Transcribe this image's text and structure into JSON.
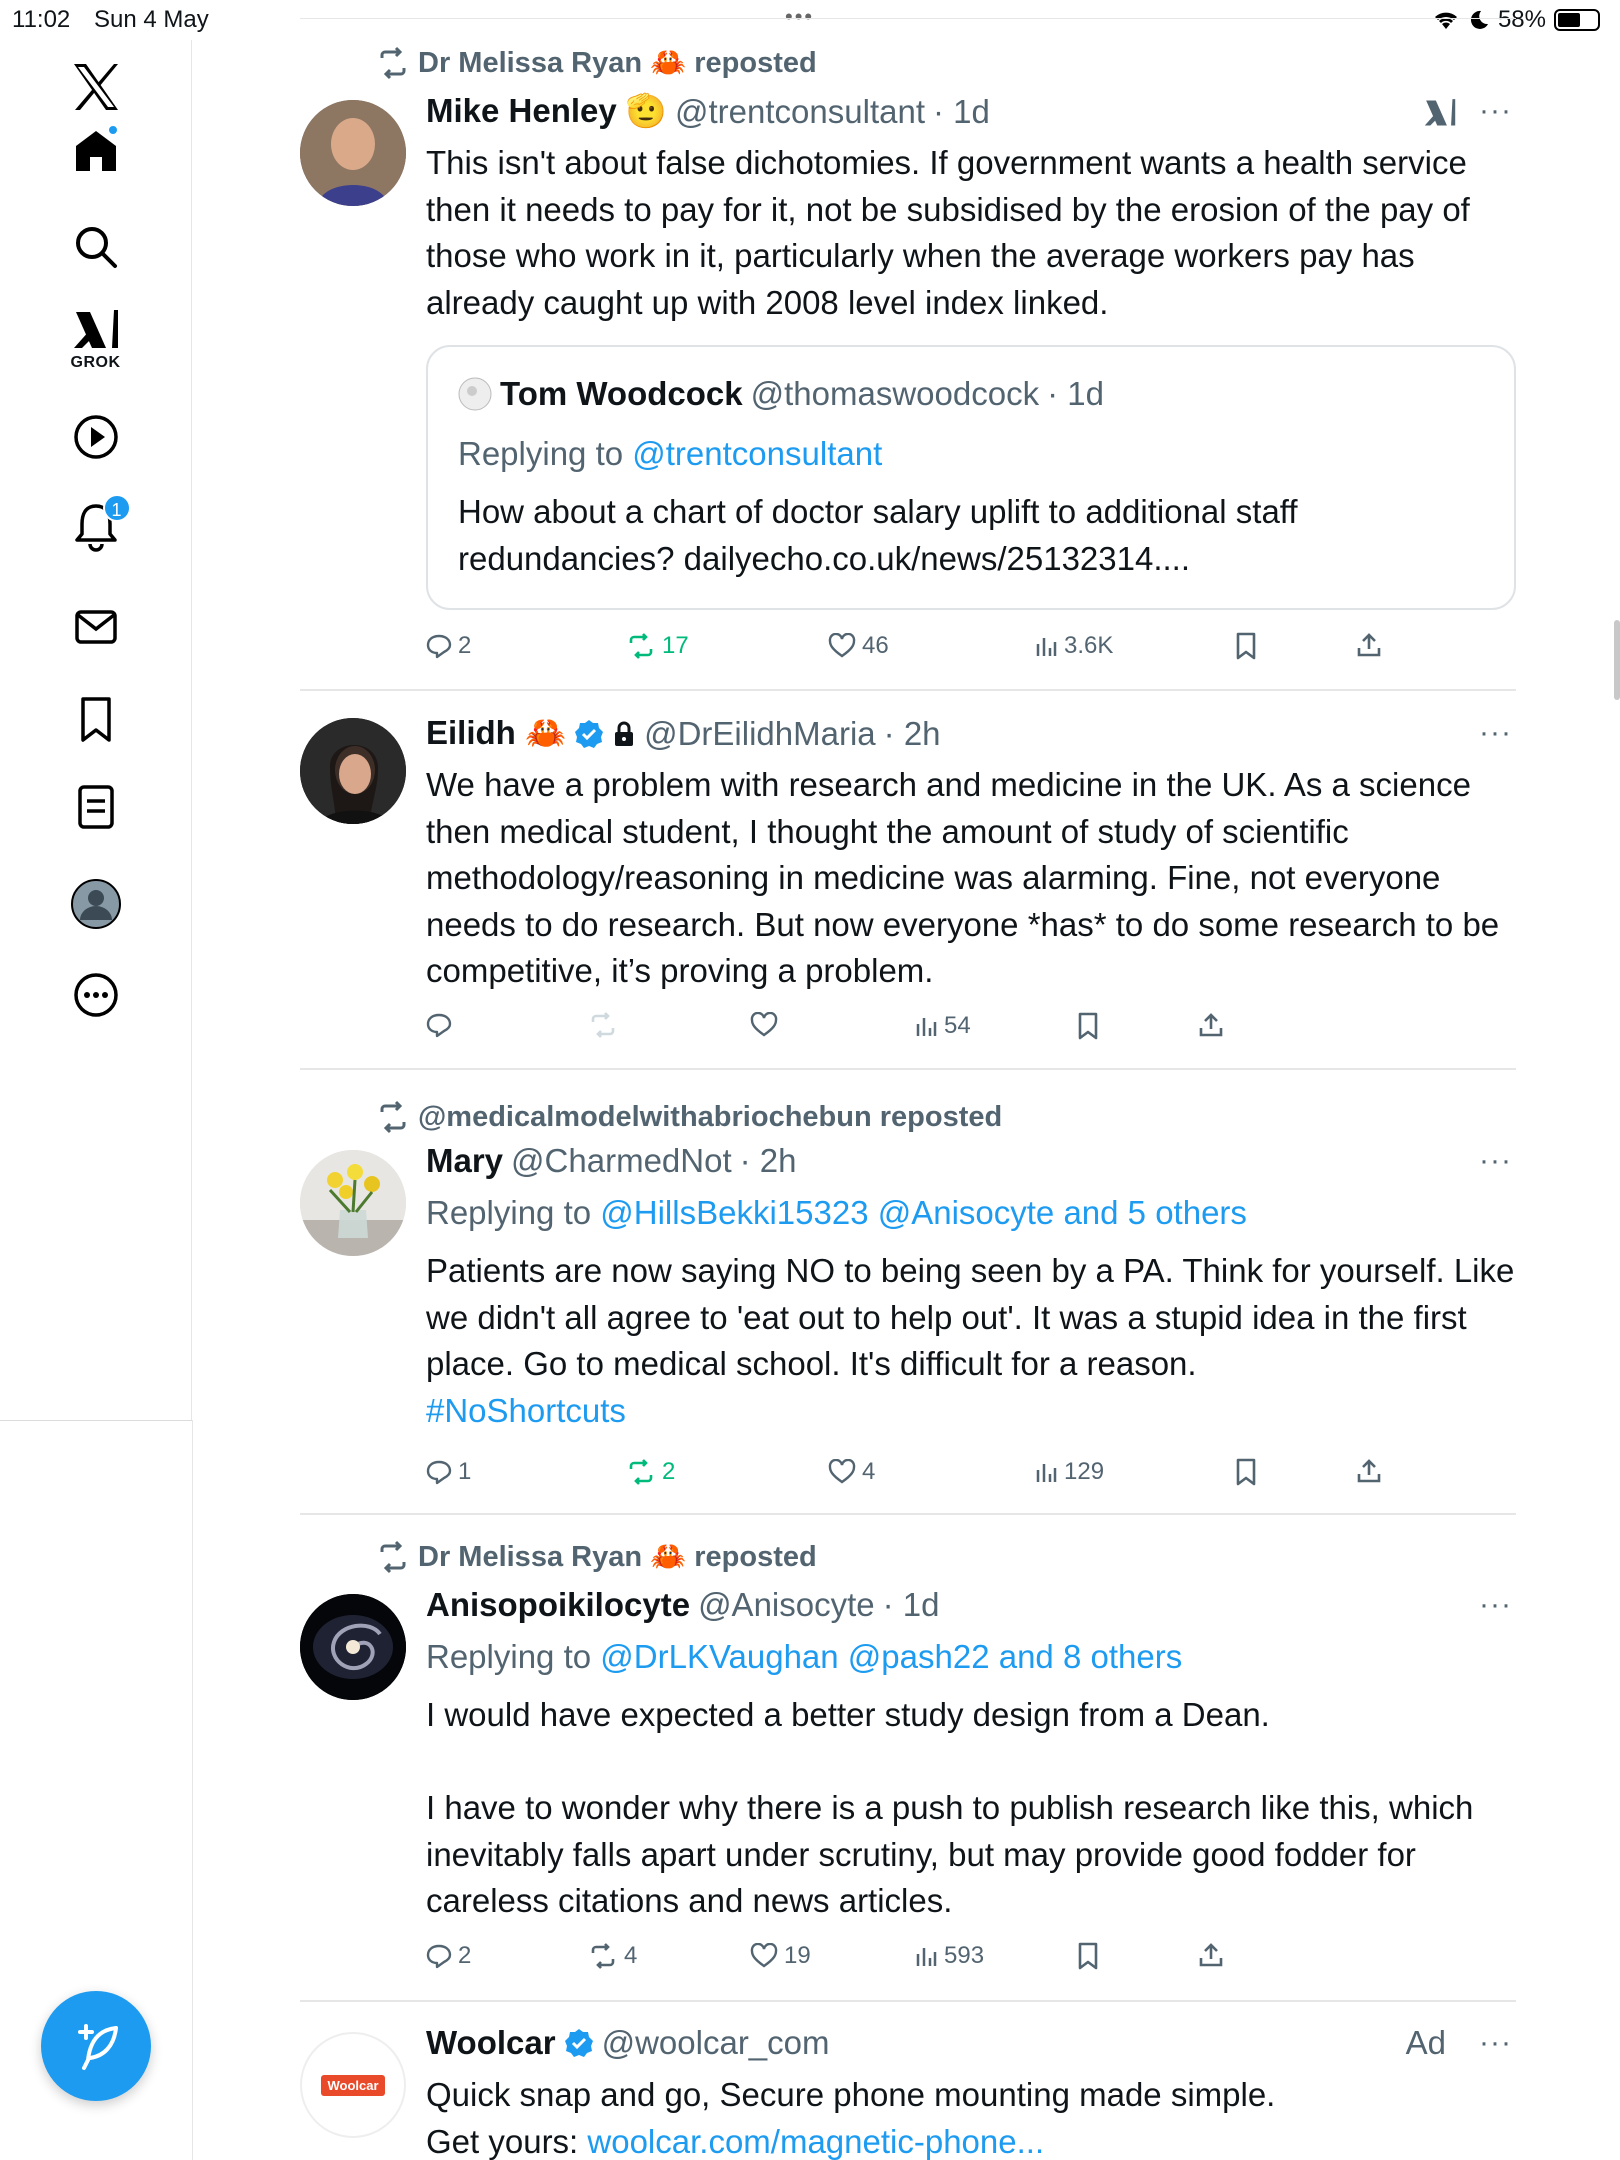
{
  "status": {
    "time": "11:02",
    "date": "Sun 4 May",
    "battery": "58%",
    "battery_level": 0.58
  },
  "sidebar": {
    "items": [
      {
        "name": "x-logo"
      },
      {
        "name": "home"
      },
      {
        "name": "search"
      },
      {
        "name": "grok",
        "label": "GROK"
      },
      {
        "name": "video"
      },
      {
        "name": "notifications",
        "badge": "1"
      },
      {
        "name": "messages"
      },
      {
        "name": "bookmarks"
      },
      {
        "name": "lists"
      },
      {
        "name": "profile"
      },
      {
        "name": "more"
      }
    ]
  },
  "tweets": [
    {
      "repost": "Dr Melissa Ryan 🦀 reposted",
      "name": "Mike Henley 🫡",
      "handle": "@trentconsultant",
      "time": "· 1d",
      "body": "This isn't about false dichotomies. If government wants a health service then it needs to pay for it, not be subsidised by the erosion of the pay of those who work in it, particularly when the average workers pay has already caught up with 2008 level index linked.",
      "quote": {
        "name": "Tom Woodcock",
        "handle": "@thomaswoodcock",
        "time": "· 1d",
        "reply_prefix": "Replying to ",
        "reply_to": "@trentconsultant",
        "body": "How about a chart of doctor salary uplift to additional staff redundancies? dailyecho.co.uk/news/25132314...."
      },
      "replies": "2",
      "reposts": "17",
      "likes": "46",
      "views": "3.6K"
    },
    {
      "name": "Eilidh 🦀",
      "handle": "@DrEilidhMaria",
      "time": "· 2h",
      "body": "We have a problem with research and medicine in the UK. As a science then medical student, I thought the amount of study of scientific methodology/reasoning in medicine was alarming. Fine, not everyone needs to do research. But now everyone *has* to do some research to be competitive, it’s proving a problem.",
      "views": "54"
    },
    {
      "repost": "@medicalmodelwithabriochebun reposted",
      "name": "Mary",
      "handle": "@CharmedNot",
      "time": "· 2h",
      "reply_prefix": "Replying to ",
      "reply_to": "@HillsBekki15323 @Anisocyte and 5 others",
      "body": "Patients are now saying NO to being seen by a PA.  Think for yourself.  Like we didn't all agree to 'eat out to help out'.  It was a stupid idea in the first place.  Go to medical school.  It's difficult for a reason.",
      "hashtag": "#NoShortcuts",
      "replies": "1",
      "reposts": "2",
      "likes": "4",
      "views": "129"
    },
    {
      "repost": "Dr Melissa Ryan 🦀 reposted",
      "name": "Anisopoikilocyte",
      "handle": "@Anisocyte",
      "time": "· 1d",
      "reply_prefix": "Replying to ",
      "reply_to": "@DrLKVaughan @pash22 and 8 others",
      "body1": "I would have expected a better study design from a Dean.",
      "body2": "I have to wonder why there is a push to publish research like this, which inevitably falls apart under scrutiny, but may provide good fodder for careless citations and news articles.",
      "replies": "2",
      "reposts": "4",
      "likes": "19",
      "views": "593"
    },
    {
      "name": "Woolcar",
      "handle": "@woolcar_com",
      "ad": "Ad",
      "avatar_text": "Woolcar",
      "body": "Quick snap and go, Secure phone mounting made simple.",
      "cta_prefix": "Get yours: ",
      "cta_link": "woolcar.com/magnetic-phone..."
    }
  ],
  "colors": {
    "accent": "#1d9bf0",
    "secondary_text": "#536471",
    "repost_green": "#00ba7c"
  }
}
